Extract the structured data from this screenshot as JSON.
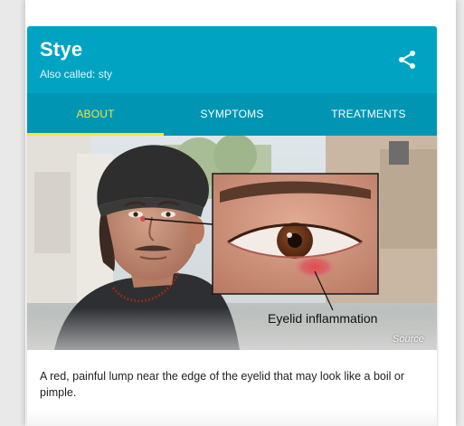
{
  "card": {
    "title": "Stye",
    "subtitle": "Also called: sty",
    "share_icon": "share-icon"
  },
  "tabs": [
    {
      "label": "ABOUT",
      "active": true
    },
    {
      "label": "SYMPTOMS",
      "active": false
    },
    {
      "label": "TREATMENTS",
      "active": false
    }
  ],
  "image": {
    "callout_label": "Eyelid inflammation",
    "source_label": "Source"
  },
  "description": "A red, painful lump near the edge of the eyelid that may look like a boil or pimple.",
  "colors": {
    "header": "#00a4c2",
    "tab_bar": "#0096b3",
    "active_tab": "#f7e53c"
  }
}
